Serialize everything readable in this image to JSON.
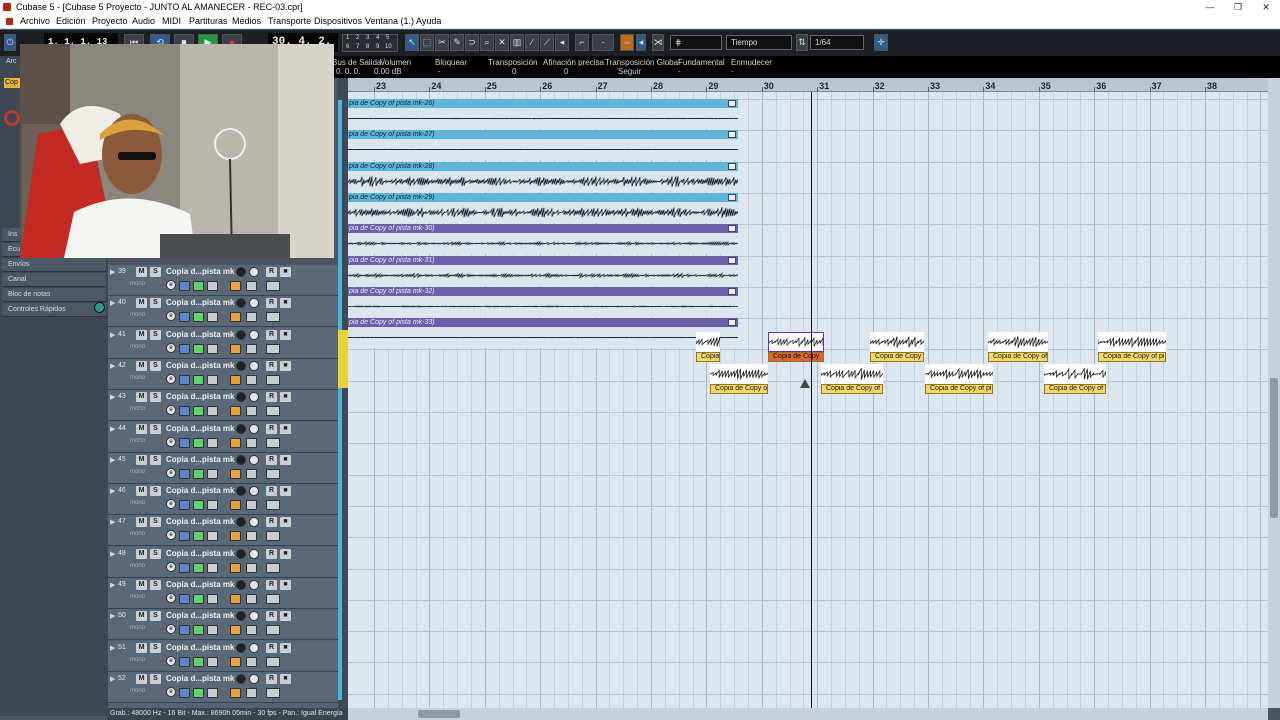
{
  "window": {
    "title": "Cubase 5 - [Cubase 5 Proyecto - JUNTO AL AMANECER - REC-03.cpr]",
    "controls": [
      "—",
      "❐",
      "✕"
    ]
  },
  "menu": [
    "Archivo",
    "Edición",
    "Proyecto",
    "Audio",
    "MIDI",
    "Partituras",
    "Medios",
    "Transporte",
    "Dispositivos",
    "Ventana (1.)",
    "Ayuda"
  ],
  "toolbar": {
    "position_left": "1. 1. 1. 13",
    "position_main": "30. 4. 2. 62",
    "grid_label": "Tiempo",
    "quantize_value": "1/64",
    "transport_buttons": [
      "⏮",
      "⟲",
      "■",
      "▶",
      "●"
    ],
    "digits": [
      "1",
      "2",
      "3",
      "4",
      "5",
      "6",
      "7",
      "8",
      "9",
      "10"
    ]
  },
  "info_line": {
    "headers": [
      "Bus de Salida",
      "Volumen",
      "Bloquear",
      "Transposición",
      "Afinación precisa",
      "Transposición Global",
      "Fundamental",
      "Enmudecer"
    ],
    "values": [
      "0. 0. 0.",
      "0.00 dB",
      "-",
      "0",
      "0",
      "Seguir",
      "-",
      "-"
    ]
  },
  "inspector": {
    "labels": [
      "Ins",
      "Ecu",
      "Envíos",
      "Canal",
      "Bloc de notas",
      "Controles Rápidos"
    ],
    "partial": [
      "Arc",
      "Cop"
    ]
  },
  "ruler": {
    "bars": [
      "23",
      "24",
      "25",
      "26",
      "27",
      "28",
      "29",
      "30",
      "31",
      "32",
      "33",
      "34",
      "35",
      "36",
      "37",
      "38"
    ]
  },
  "events": [
    {
      "label": "pia de Copy of pista mk-26)",
      "color": "blue"
    },
    {
      "label": "pia de Copy of pista mk-27)",
      "color": "blue"
    },
    {
      "label": "pia de Copy of pista mk-28)",
      "color": "blue"
    },
    {
      "label": "pia de Copy of pista mk-29)",
      "color": "blue"
    },
    {
      "label": "pia de Copy of pista mk-30)",
      "color": "purple"
    },
    {
      "label": "pia de Copy of pista mk-31)",
      "color": "purple"
    },
    {
      "label": "pia de Copy of pista mk-32)",
      "color": "purple"
    },
    {
      "label": "pia de Copy of pista mk-33)",
      "color": "purple"
    }
  ],
  "clips_row1": [
    "Copia",
    "Copia de Copy",
    "Copia de Copy",
    "Copia de Copy of",
    "Copia de Copy of pi"
  ],
  "clips_row2": [
    "Copia de Copy o",
    "Copia de Copy of",
    "Copia de Copy of pi",
    "Copia de Copy of"
  ],
  "tracks": [
    {
      "num": "39",
      "name": "Copia d...pista mk",
      "mode": "mono"
    },
    {
      "num": "40",
      "name": "Copia d...pista mk",
      "mode": "mono"
    },
    {
      "num": "41",
      "name": "Copia d...pista mk",
      "mode": "mono"
    },
    {
      "num": "42",
      "name": "Copia d...pista mk",
      "mode": "mono"
    },
    {
      "num": "43",
      "name": "Copia d...pista mk",
      "mode": "mono"
    },
    {
      "num": "44",
      "name": "Copia d...pista mk",
      "mode": "mono"
    },
    {
      "num": "45",
      "name": "Copia d...pista mk",
      "mode": "mono"
    },
    {
      "num": "46",
      "name": "Copia d...pista mk",
      "mode": "mono"
    },
    {
      "num": "47",
      "name": "Copia d...pista mk",
      "mode": "mono"
    },
    {
      "num": "48",
      "name": "Copia d...pista mk",
      "mode": "mono"
    },
    {
      "num": "49",
      "name": "Copia d...pista mk",
      "mode": "mono"
    },
    {
      "num": "50",
      "name": "Copia d...pista mk",
      "mode": "mono"
    },
    {
      "num": "51",
      "name": "Copia d...pista mk",
      "mode": "mono"
    },
    {
      "num": "52",
      "name": "Copia d...pista mk",
      "mode": "mono"
    }
  ],
  "track_buttons": {
    "mute": "M",
    "solo": "S",
    "read": "R",
    "edit": "e"
  },
  "statusbar": "Grab.: 48000 Hz - 16 Bit - Max.: 8690h 05min - 30 fps - Pan.: Igual Energía",
  "colors": {
    "accent_blue": "#5db6d9",
    "event_purple": "#6b5fa8",
    "clip_yellow": "#f2d86a",
    "clip_selected": "#e0652c",
    "arrange_bg": "#dde6ee"
  }
}
